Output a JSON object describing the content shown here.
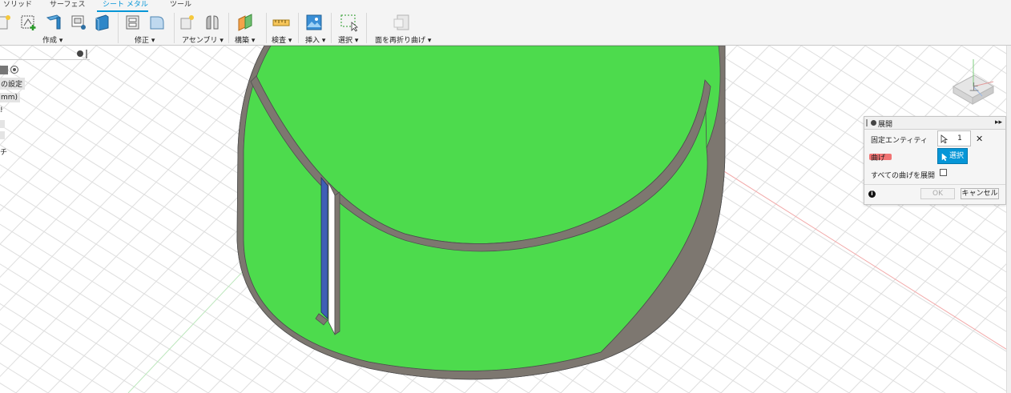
{
  "ribbon": {
    "tabs": [
      "ソリッド",
      "サーフェス",
      "シート メタル",
      "ツール"
    ],
    "active_tab": "シート メタル",
    "groups": {
      "create": "作成 ▾",
      "modify": "修正 ▾",
      "assemble": "アセンブリ ▾",
      "construct": "構築 ▾",
      "inspect": "検査 ▾",
      "insert": "挿入 ▾",
      "select": "選択 ▾",
      "refold": "面を再折り曲げ ▾"
    }
  },
  "browser": {
    "rows": [
      "の設定",
      "mm)",
      "!",
      "チ"
    ]
  },
  "dialog": {
    "title": "展開",
    "fixed_entity_label": "固定エンティティ",
    "fixed_entity_value": "1 選...",
    "bends_label": "曲げ",
    "bends_button": "選択",
    "unfold_all_label": "すべての曲げを展開",
    "ok": "OK",
    "cancel": "キャンセル"
  },
  "view_cube": {
    "face": "上"
  },
  "colors": {
    "accent": "#0696d7",
    "ribbon_bg": "#f4f4f4",
    "sheet_face": "#4ddb4d",
    "sheet_edge": "#7d7770",
    "selected_face": "#3f5fb6",
    "x_axis": "#f2a8a8",
    "y_axis": "#bde7bd"
  }
}
